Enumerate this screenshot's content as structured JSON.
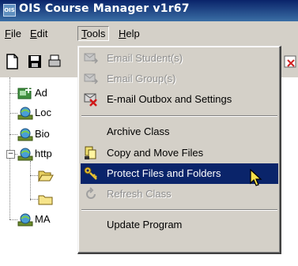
{
  "window": {
    "title": "OIS Course Manager v1r67",
    "app_icon_text": "OIS"
  },
  "menubar": {
    "items": [
      {
        "label": "File",
        "mnemonic": "F",
        "rest": "ile"
      },
      {
        "label": "Edit",
        "mnemonic": "E",
        "rest": "dit"
      },
      {
        "label": "Tools",
        "mnemonic": "T",
        "rest": "ools",
        "open": true
      },
      {
        "label": "Help",
        "mnemonic": "H",
        "rest": "elp"
      }
    ]
  },
  "toolbar": {
    "buttons": [
      "new-document-icon",
      "save-disk-icon",
      "print-icon"
    ]
  },
  "tree": {
    "items": [
      {
        "label": "Ad",
        "icon": "add-class-icon"
      },
      {
        "label": "Loc",
        "icon": "globe-icon"
      },
      {
        "label": "Bio",
        "icon": "globe-icon"
      },
      {
        "label": "http",
        "icon": "globe-icon",
        "expander": "−"
      },
      {
        "label": "",
        "icon": "folder-open-icon"
      },
      {
        "label": "",
        "icon": "folder-icon"
      },
      {
        "label": "MA",
        "icon": "globe-icon"
      }
    ]
  },
  "tools_menu": {
    "items": [
      {
        "label": "Email Student(s)",
        "icon": "email-student-icon",
        "disabled": true
      },
      {
        "label": "Email Group(s)",
        "icon": "email-group-icon",
        "disabled": true
      },
      {
        "label": "E-mail Outbox and Settings",
        "icon": "email-outbox-icon",
        "disabled": false
      },
      {
        "label": "Archive Class",
        "icon": "",
        "disabled": false
      },
      {
        "label": "Copy and Move Files",
        "icon": "copy-move-icon",
        "disabled": false
      },
      {
        "label": "Protect Files and Folders",
        "icon": "key-icon",
        "disabled": false,
        "highlighted": true
      },
      {
        "label": "Refresh Class",
        "icon": "refresh-icon",
        "disabled": true
      },
      {
        "label": "Update Program",
        "icon": "",
        "disabled": false
      }
    ]
  },
  "colors": {
    "menu_face": "#d4d0c8",
    "highlight": "#0a246a",
    "title_start": "#0a246a",
    "title_end": "#3a6ea5"
  }
}
